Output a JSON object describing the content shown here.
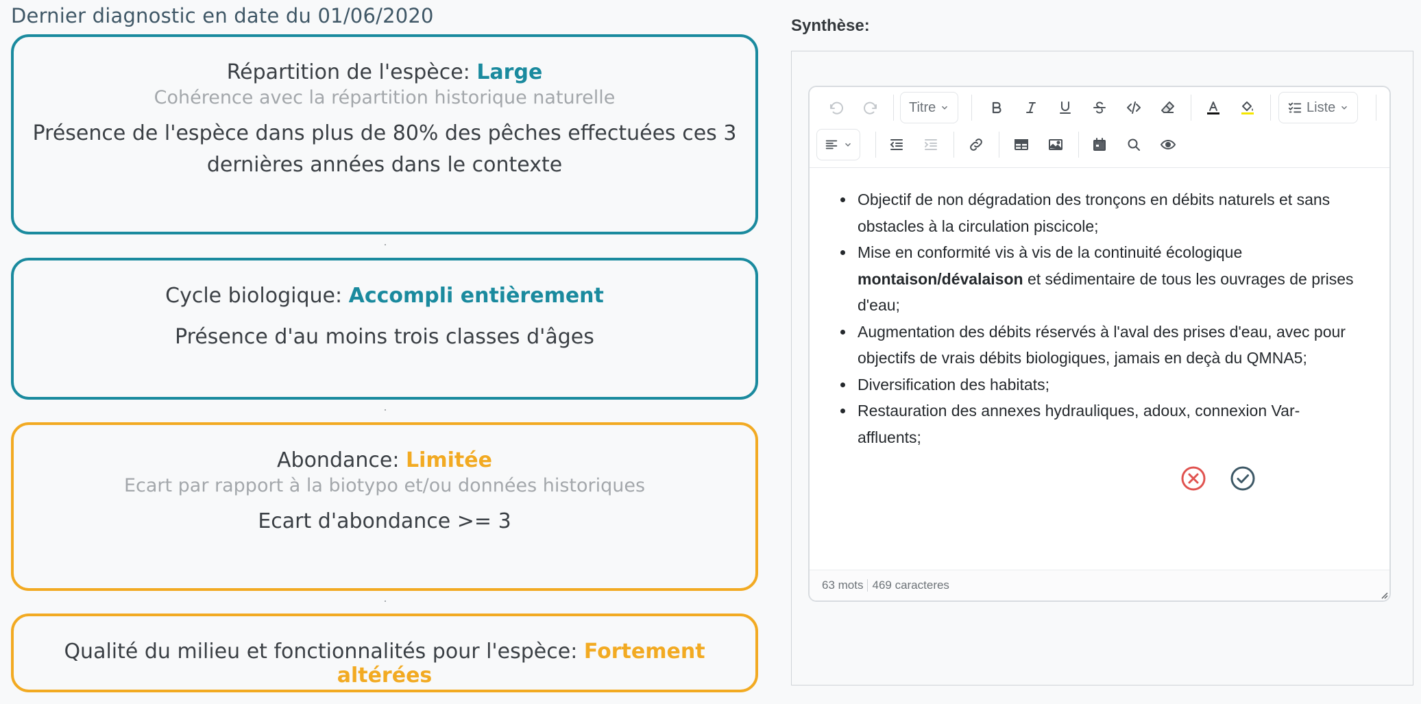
{
  "diagnostic": {
    "header": "Dernier diagnostic en date du 01/06/2020",
    "cards": [
      {
        "label": "Répartition de l'espèce: ",
        "value": "Large",
        "subtitle": "Cohérence avec la répartition historique naturelle",
        "desc_line1": "Présence de l'espèce dans plus de 80% des pêches effectuées ces 3",
        "desc_line2": "dernières années dans le contexte",
        "status_color": "#1a8a9e"
      },
      {
        "label": "Cycle biologique: ",
        "value": "Accompli entièrement",
        "description": "Présence d'au moins trois classes d'âges",
        "status_color": "#1a8a9e"
      },
      {
        "label": "Abondance: ",
        "value": "Limitée",
        "subtitle": "Ecart par rapport à la biotypo et/ou données historiques",
        "description": "Ecart d'abondance >= 3",
        "status_color": "#f2aa22"
      },
      {
        "label": "Qualité du milieu et fonctionnalités pour l'espèce: ",
        "value": "Fortement altérées",
        "status_color": "#f2aa22"
      }
    ]
  },
  "synthese": {
    "label": "Synthèse:",
    "toolbar": {
      "heading_dropdown": "Titre",
      "list_dropdown": "Liste",
      "icons": [
        "undo-icon",
        "redo-icon",
        "bold-icon",
        "italic-icon",
        "underline-icon",
        "strikethrough-icon",
        "code-icon",
        "eraser-icon",
        "text-color-icon",
        "highlight-icon",
        "checklist-icon",
        "align-left-icon",
        "outdent-icon",
        "indent-icon",
        "link-icon",
        "table-icon",
        "image-icon",
        "calendar-icon",
        "search-icon",
        "eye-icon"
      ]
    },
    "items": [
      {
        "text": "Objectif de non dégradation des tronçons en débits naturels et sans obstacles à la circulation piscicole;"
      },
      {
        "before": "Mise en conformité vis à vis de la continuité écologique ",
        "bold": "montaison/dévalaison",
        "after": " et sédimentaire de tous les ouvrages de prises d'eau;"
      },
      {
        "text": "Augmentation des débits réservés à l'aval des prises d'eau, avec pour objectifs de vrais débits biologiques, jamais en deçà du QMNA5;"
      },
      {
        "text": "Diversification des habitats;"
      },
      {
        "text": "Restauration des annexes hydrauliques, adoux, connexion Var-affluents;"
      }
    ],
    "word_count": "63 mots",
    "char_count": "469 caracteres",
    "cancel_color": "#e0524f",
    "confirm_color": "#3d5866"
  }
}
